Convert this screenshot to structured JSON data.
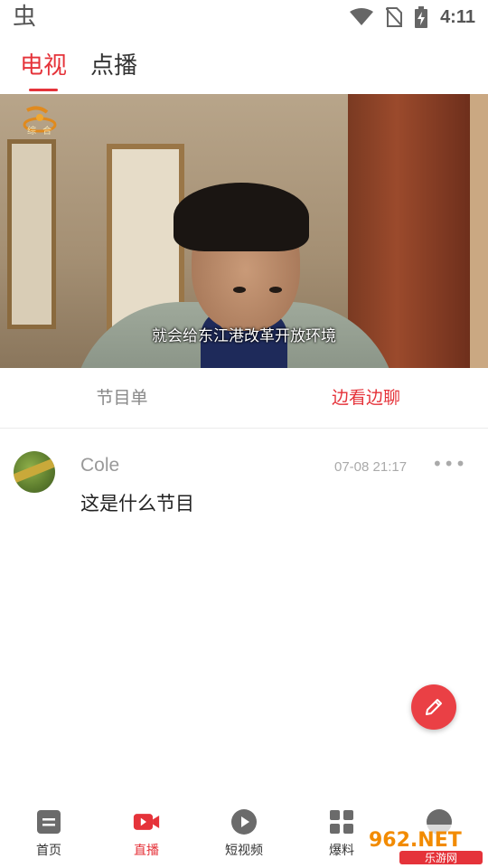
{
  "status_bar": {
    "app_glyph": "虫",
    "time": "4:11",
    "icons": [
      "wifi-icon",
      "no-sim-icon",
      "battery-charging-icon"
    ]
  },
  "top_tabs": [
    {
      "label": "电视",
      "active": true
    },
    {
      "label": "点播",
      "active": false
    }
  ],
  "video": {
    "channel_logo_text": "综 合",
    "subtitle": "就会给东江港改革开放环境"
  },
  "sub_tabs": [
    {
      "label": "节目单",
      "active": false
    },
    {
      "label": "边看边聊",
      "active": true
    }
  ],
  "comments": [
    {
      "user": "Cole",
      "time": "07-08 21:17",
      "text": "这是什么节目",
      "more": "•••"
    }
  ],
  "fab": {
    "icon": "pencil-icon"
  },
  "bottom_nav": [
    {
      "label": "首页",
      "icon": "home-icon",
      "active": false
    },
    {
      "label": "直播",
      "icon": "video-camera-icon",
      "active": true
    },
    {
      "label": "短视频",
      "icon": "play-icon",
      "active": false
    },
    {
      "label": "爆料",
      "icon": "grid-icon",
      "active": false
    },
    {
      "label": "",
      "icon": "profile-icon",
      "active": false
    }
  ],
  "watermark": {
    "text": "962.NET",
    "subtext": "乐游网"
  },
  "colors": {
    "accent": "#e5333a",
    "fab": "#ea4045",
    "muted": "#999999"
  }
}
